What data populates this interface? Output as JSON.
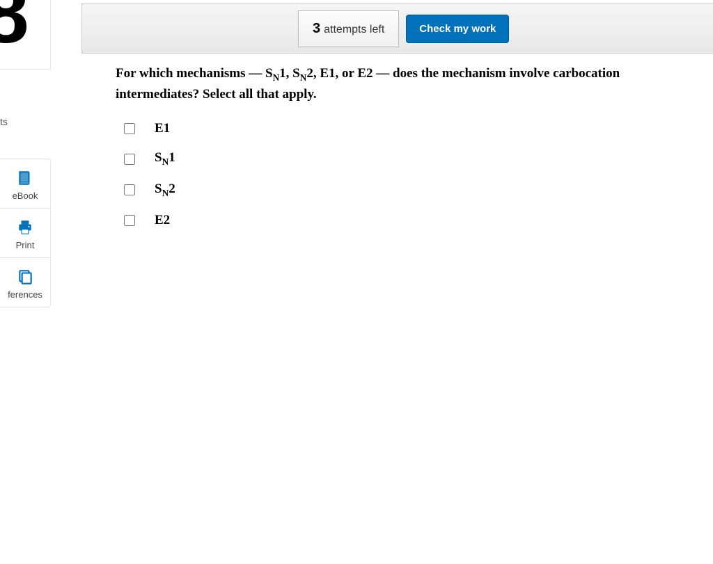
{
  "question_number": "8",
  "left_label_partial": "ts",
  "toolbar": {
    "attempts_number": "3",
    "attempts_text": "attempts left",
    "check_label": "Check my work"
  },
  "sidebar": {
    "items": [
      {
        "label": "eBook"
      },
      {
        "label": "Print"
      },
      {
        "label": "ferences"
      }
    ]
  },
  "question": {
    "prompt_prefix": "For which mechanisms — ",
    "prompt_s": "S",
    "prompt_n": "N",
    "prompt_1": "1, ",
    "prompt_2": "2, E1, or E2 — does the mechanism involve carbocation intermediates? Select all that apply.",
    "options": [
      {
        "label": "E1",
        "has_sub": false
      },
      {
        "label_s": "S",
        "label_n": "N",
        "label_num": "1",
        "has_sub": true
      },
      {
        "label_s": "S",
        "label_n": "N",
        "label_num": "2",
        "has_sub": true
      },
      {
        "label": "E2",
        "has_sub": false
      }
    ]
  }
}
